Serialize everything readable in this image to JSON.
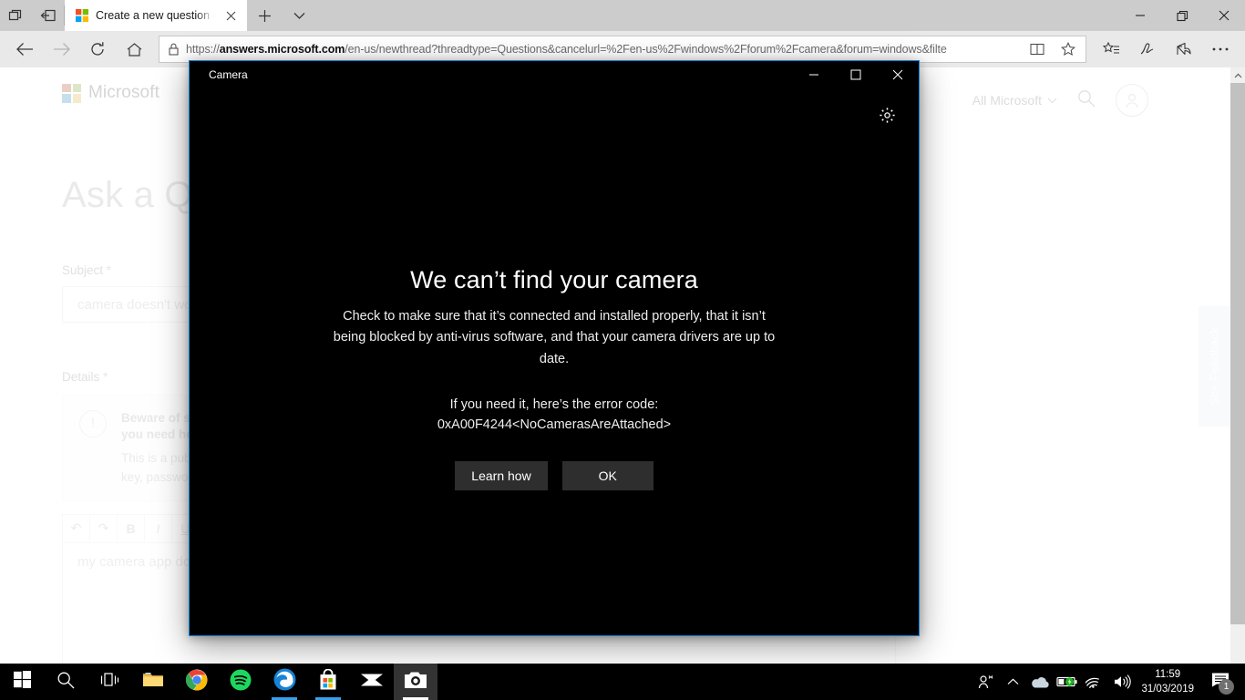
{
  "browser": {
    "name": "Microsoft Edge",
    "tab_preview_icon": "tab-preview-icon",
    "set_aside_icon": "set-aside-tabs-icon",
    "tabs": [
      {
        "title": "Create a new question c",
        "favicon": "microsoft-favicon",
        "close_icon": "close-icon"
      }
    ],
    "new_tab_label": "+",
    "tab_menu_icon": "chevron-down-icon",
    "window_controls": {
      "minimize": "minimize-icon",
      "restore": "restore-icon",
      "close": "close-icon"
    },
    "nav": {
      "back_icon": "back-arrow-icon",
      "forward_icon": "forward-arrow-icon",
      "refresh_icon": "refresh-icon",
      "home_icon": "home-icon"
    },
    "address": {
      "lock_icon": "lock-icon",
      "scheme": "https://",
      "host": "answers.microsoft.com",
      "path": "/en-us/newthread?threadtype=Questions&cancelurl=%2Fen-us%2Fwindows%2Fforum%2Fcamera&forum=windows&filte",
      "full_url": "https://answers.microsoft.com/en-us/newthread?threadtype=Questions&cancelurl=%2Fen-us%2Fwindows%2Fforum%2Fcamera&forum=windows&filte",
      "reading_view_icon": "reading-view-icon",
      "favorite_icon": "star-icon"
    },
    "toolbar_icons": [
      "favorites-list-icon",
      "web-notes-pen-icon",
      "share-icon",
      "settings-ellipsis-icon"
    ]
  },
  "page": {
    "header": {
      "logo_text": "Microsoft",
      "logo_icon": "microsoft-logo-icon",
      "all_microsoft_label": "All Microsoft",
      "all_microsoft_chevron": "chevron-down-icon",
      "search_icon": "search-icon",
      "account_icon": "account-avatar-icon"
    },
    "title": "Ask a Qu",
    "subject": {
      "label": "Subject",
      "required_marker": "*",
      "value": "camera doesn't wor"
    },
    "details": {
      "label": "Details",
      "required_marker": "*",
      "notice_icon": "exclamation-circle-icon",
      "notice_bold": "Beware of scal\nyou need help",
      "notice_bold_line1": "Beware of sca",
      "notice_bold_line2": "you need help",
      "notice_body_line1": "This is a public",
      "notice_body_line2": "key, password,",
      "editor_toolbar": [
        {
          "name": "undo-button",
          "glyph": "↶"
        },
        {
          "name": "redo-button",
          "glyph": "↷"
        },
        {
          "name": "bold-button",
          "glyph": "B"
        },
        {
          "name": "italic-button",
          "glyph": "I"
        },
        {
          "name": "underline-button",
          "glyph": "U"
        }
      ],
      "editor_value": "my camera app doe"
    },
    "feedback_tab_label": "Site Feedback",
    "scrollbar": {
      "up_arrow": "scroll-up-arrow-icon"
    }
  },
  "camera_dialog": {
    "window_title": "Camera",
    "settings_icon": "gear-icon",
    "controls": {
      "minimize": "minimize-icon",
      "maximize": "maximize-icon",
      "close": "close-icon"
    },
    "heading": "We can’t find your camera",
    "body": "Check to make sure that it’s connected and installed properly, that it isn’t being blocked by anti-virus software, and that your camera drivers are up to date.",
    "error_intro": "If you need it, here’s the error code:",
    "error_code": "0xA00F4244<NoCamerasAreAttached>",
    "buttons": [
      {
        "label": "Learn how",
        "name": "learn-how-button"
      },
      {
        "label": "OK",
        "name": "ok-button"
      }
    ],
    "border_color": "#0a84d8",
    "background_color": "#000000",
    "button_color": "#2e2e2e"
  },
  "taskbar": {
    "items": [
      {
        "name": "start-button",
        "icon": "windows-logo-icon"
      },
      {
        "name": "search-button",
        "icon": "search-icon"
      },
      {
        "name": "task-view-button",
        "icon": "task-view-icon"
      },
      {
        "name": "file-explorer-button",
        "icon": "file-explorer-icon",
        "running": false
      },
      {
        "name": "chrome-button",
        "icon": "chrome-icon",
        "running": false
      },
      {
        "name": "spotify-button",
        "icon": "spotify-icon",
        "running": false
      },
      {
        "name": "edge-button",
        "icon": "edge-icon",
        "running": true
      },
      {
        "name": "microsoft-store-button",
        "icon": "microsoft-store-icon",
        "running": true
      },
      {
        "name": "mail-button",
        "icon": "mail-icon",
        "running": false
      },
      {
        "name": "camera-button",
        "icon": "camera-icon",
        "running": true,
        "active": true
      }
    ],
    "tray": {
      "people_icon": "people-icon",
      "show_hidden_icon": "chevron-up-icon",
      "onedrive_icon": "onedrive-cloud-icon",
      "battery_icon": "battery-charging-icon",
      "network_icon": "wifi-icon",
      "volume_icon": "volume-icon",
      "time": "11:59",
      "date": "31/03/2019",
      "notifications_icon": "action-center-icon",
      "notifications_count": "1"
    }
  }
}
